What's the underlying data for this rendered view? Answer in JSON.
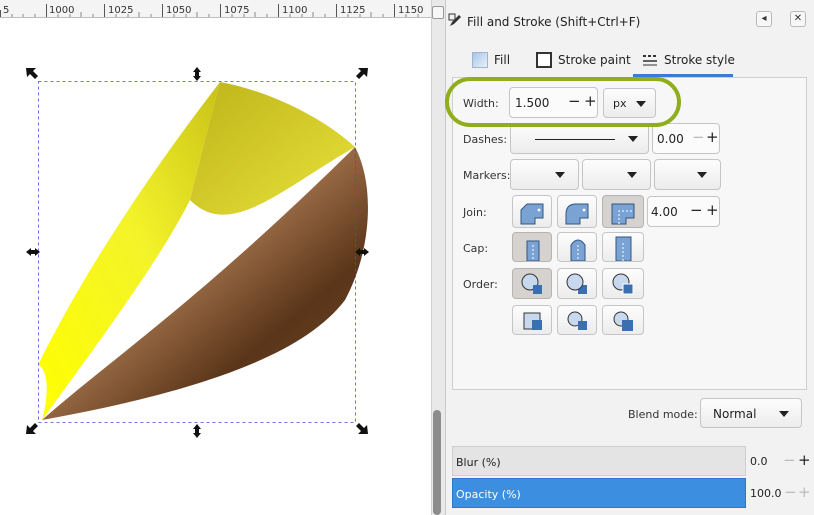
{
  "ruler": {
    "labels": [
      "5",
      "1000",
      "1025",
      "1050",
      "1075",
      "1100",
      "1125",
      "1150"
    ]
  },
  "dialog": {
    "title": "Fill and Stroke (Shift+Ctrl+F)",
    "restore_glyph": "◂",
    "close_glyph": "✕"
  },
  "tabs": [
    {
      "label": "Fill",
      "icon": "fill-swatch-icon"
    },
    {
      "label": "Stroke paint",
      "icon": "stroke-paint-icon"
    },
    {
      "label": "Stroke style",
      "icon": "stroke-style-icon",
      "active": true
    }
  ],
  "stroke_style": {
    "width_label": "Width:",
    "width_value": "1.500",
    "unit": "px",
    "dashes_label": "Dashes:",
    "dash_offset": "0.00",
    "markers_label": "Markers:",
    "join_label": "Join:",
    "miter_limit": "4.00",
    "cap_label": "Cap:",
    "order_label": "Order:",
    "minus_glyph": "−",
    "plus_glyph": "+"
  },
  "blend": {
    "label": "Blend mode:",
    "value": "Normal"
  },
  "blur": {
    "label": "Blur (%)",
    "value": "0.0"
  },
  "opacity": {
    "label": "Opacity (%)",
    "value": "100.0"
  },
  "colors": {
    "accent": "#3b8ee0",
    "highlight_ring": "#8fad1c",
    "shape_yellow": "#f2f21a",
    "shape_brown": "#6b4325"
  }
}
